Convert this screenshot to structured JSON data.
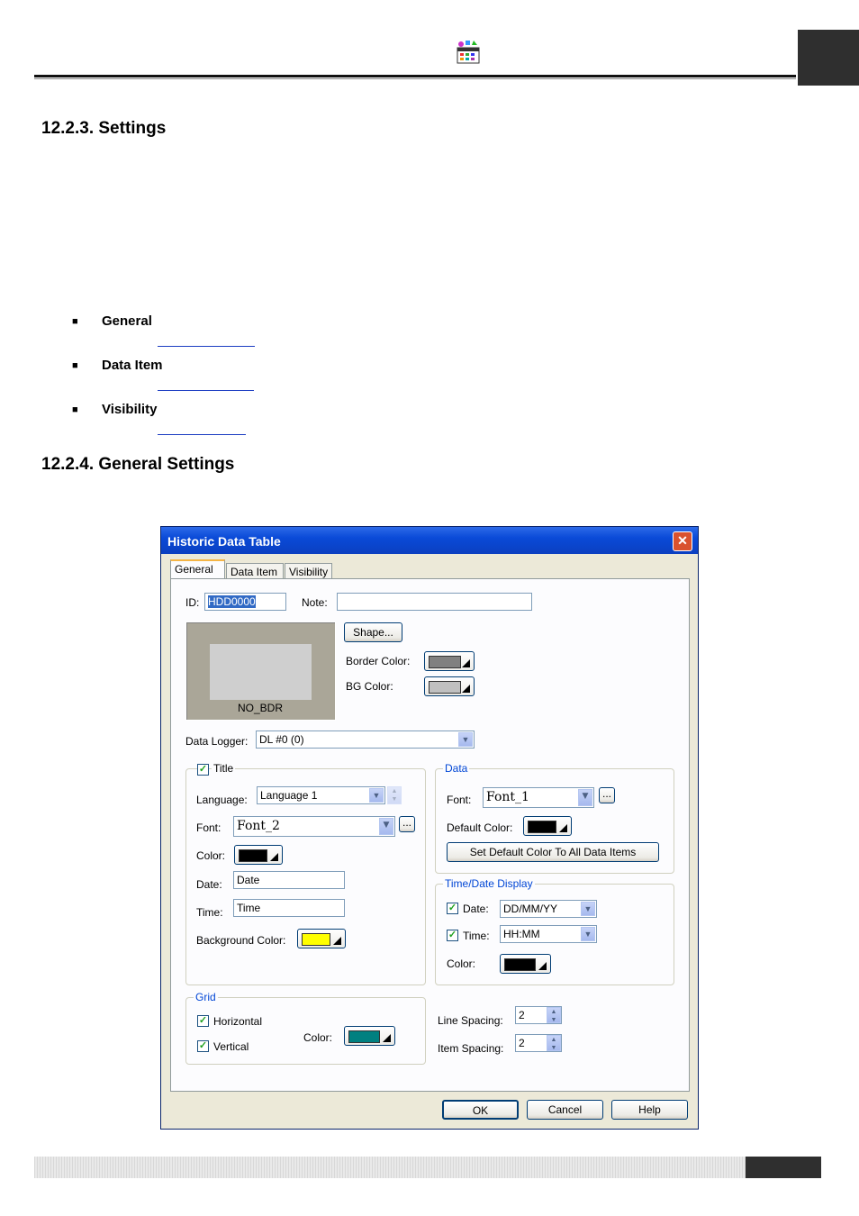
{
  "page": {
    "section1_title": "12.2.3. Settings",
    "bullets": [
      "General",
      "Data Item",
      "Visibility"
    ],
    "section2_title": "12.2.4. General Settings"
  },
  "dialog": {
    "title": "Historic Data Table",
    "tabs": [
      "General",
      "Data Item",
      "Visibility"
    ],
    "id_label": "ID:",
    "id_value": "HDD0000",
    "note_label": "Note:",
    "note_value": "",
    "preview_label": "NO_BDR",
    "shape_button": "Shape...",
    "border_color_label": "Border Color:",
    "border_color": "#808080",
    "bg_color_label": "BG Color:",
    "bg_color": "#c0c0c0",
    "data_logger_label": "Data Logger:",
    "data_logger_value": "DL #0 (0)",
    "title_group": {
      "title_checkbox": "Title",
      "language_label": "Language:",
      "language_value": "Language 1",
      "font_label": "Font:",
      "font_value": "Font_2",
      "color_label": "Color:",
      "color": "#000000",
      "date_label": "Date:",
      "date_value": "Date",
      "time_label": "Time:",
      "time_value": "Time",
      "bg_color_label": "Background Color:",
      "bg_color": "#ffff00"
    },
    "data_group": {
      "legend": "Data",
      "font_label": "Font:",
      "font_value": "Font_1",
      "default_color_label": "Default Color:",
      "default_color": "#000000",
      "set_default_button": "Set Default Color To All Data Items"
    },
    "timedate_group": {
      "legend": "Time/Date Display",
      "date_label": "Date:",
      "date_value": "DD/MM/YY",
      "time_label": "Time:",
      "time_value": "HH:MM",
      "color_label": "Color:",
      "color": "#000000"
    },
    "grid_group": {
      "legend": "Grid",
      "horizontal_label": "Horizontal",
      "vertical_label": "Vertical",
      "color_label": "Color:",
      "color": "#008080"
    },
    "line_spacing_label": "Line Spacing:",
    "line_spacing_value": "2",
    "item_spacing_label": "Item Spacing:",
    "item_spacing_value": "2",
    "ok_button": "OK",
    "cancel_button": "Cancel",
    "help_button": "Help",
    "ellipsis": "..."
  }
}
